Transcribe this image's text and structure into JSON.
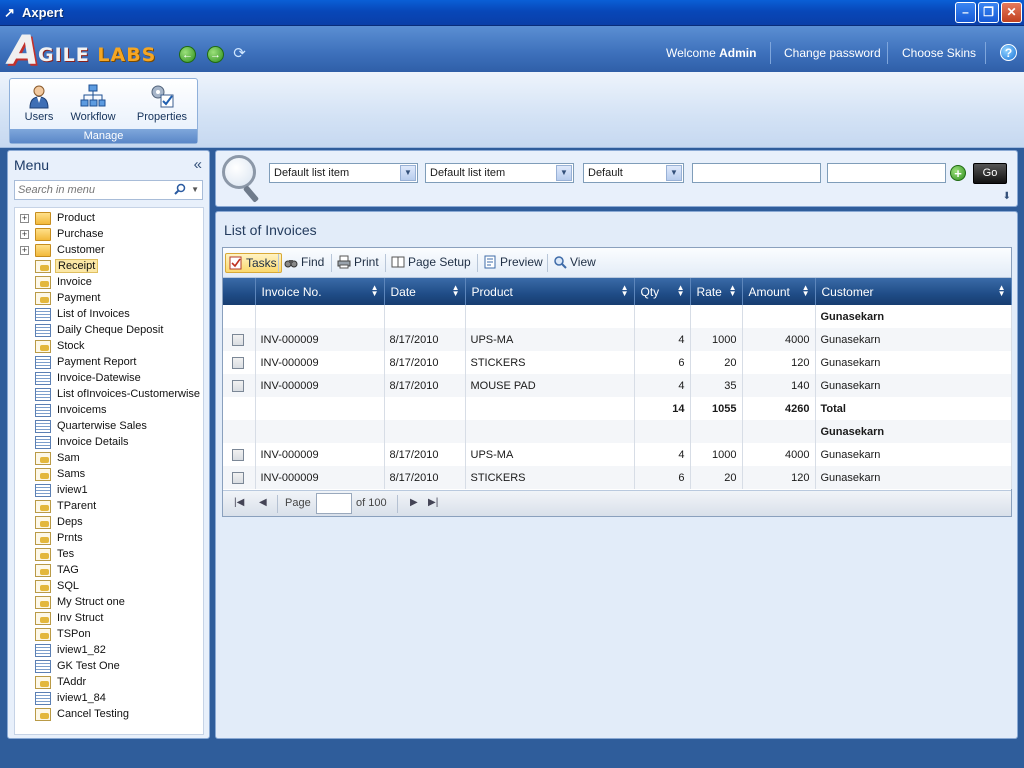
{
  "window": {
    "title": "Axpert"
  },
  "header": {
    "logo_a": "A",
    "logo_gile": "GILE",
    "logo_labs": "LABS",
    "welcome_prefix": "Welcome",
    "user": "Admin",
    "change_password": "Change password",
    "choose_skins": "Choose Skins"
  },
  "ribbon": {
    "items": [
      {
        "label": "Users",
        "icon": "user-icon"
      },
      {
        "label": "Workflow",
        "icon": "workflow-icon"
      },
      {
        "label": "Properties",
        "icon": "properties-icon"
      }
    ],
    "group_caption": "Manage"
  },
  "menu": {
    "title": "Menu",
    "search_placeholder": "Search in menu",
    "items": [
      {
        "label": "Product",
        "type": "folder",
        "expandable": true
      },
      {
        "label": "Purchase",
        "type": "folder",
        "expandable": true
      },
      {
        "label": "Customer",
        "type": "folder",
        "expandable": true
      },
      {
        "label": "Receipt",
        "type": "form",
        "selected": true
      },
      {
        "label": "Invoice",
        "type": "form"
      },
      {
        "label": "Payment",
        "type": "form"
      },
      {
        "label": "List of Invoices",
        "type": "grid"
      },
      {
        "label": "Daily Cheque Deposit",
        "type": "grid"
      },
      {
        "label": "Stock",
        "type": "form"
      },
      {
        "label": "Payment Report",
        "type": "grid"
      },
      {
        "label": "Invoice-Datewise",
        "type": "grid"
      },
      {
        "label": "List ofInvoices-Customerwise",
        "type": "grid"
      },
      {
        "label": "Invoicems",
        "type": "grid"
      },
      {
        "label": "Quarterwise Sales",
        "type": "grid"
      },
      {
        "label": "Invoice Details",
        "type": "grid"
      },
      {
        "label": "Sam",
        "type": "form"
      },
      {
        "label": "Sams",
        "type": "form"
      },
      {
        "label": "iview1",
        "type": "grid"
      },
      {
        "label": "TParent",
        "type": "form"
      },
      {
        "label": "Deps",
        "type": "form"
      },
      {
        "label": "Prnts",
        "type": "form"
      },
      {
        "label": "Tes",
        "type": "form"
      },
      {
        "label": "TAG",
        "type": "form"
      },
      {
        "label": "SQL",
        "type": "form"
      },
      {
        "label": "My Struct one",
        "type": "form"
      },
      {
        "label": "Inv Struct",
        "type": "form"
      },
      {
        "label": "TSPon",
        "type": "form"
      },
      {
        "label": "iview1_82",
        "type": "grid"
      },
      {
        "label": "GK Test One",
        "type": "grid"
      },
      {
        "label": "TAddr",
        "type": "form"
      },
      {
        "label": "iview1_84",
        "type": "grid"
      },
      {
        "label": "Cancel Testing",
        "type": "form"
      }
    ]
  },
  "filter": {
    "select1": "Default list item",
    "select2": "Default list item",
    "select3": "Default",
    "go_label": "Go"
  },
  "page": {
    "title": "List of Invoices"
  },
  "toolbar": {
    "tasks": "Tasks",
    "find": "Find",
    "print": "Print",
    "page_setup": "Page Setup",
    "preview": "Preview",
    "view": "View"
  },
  "grid": {
    "columns": [
      "Invoice No.",
      "Date",
      "Product",
      "Qty",
      "Rate",
      "Amount",
      "Customer"
    ],
    "rows": [
      {
        "kind": "group",
        "customer": "Gunasekarn"
      },
      {
        "kind": "data",
        "invoice": "INV-000009",
        "date": "8/17/2010",
        "product": "UPS-MA",
        "qty": "4",
        "rate": "1000",
        "amount": "4000",
        "customer": "Gunasekarn"
      },
      {
        "kind": "data",
        "invoice": "INV-000009",
        "date": "8/17/2010",
        "product": "STICKERS",
        "qty": "6",
        "rate": "20",
        "amount": "120",
        "customer": "Gunasekarn"
      },
      {
        "kind": "data",
        "invoice": "INV-000009",
        "date": "8/17/2010",
        "product": "MOUSE PAD",
        "qty": "4",
        "rate": "35",
        "amount": "140",
        "customer": "Gunasekarn"
      },
      {
        "kind": "total",
        "qty": "14",
        "rate": "1055",
        "amount": "4260",
        "customer": "Total"
      },
      {
        "kind": "group",
        "customer": "Gunasekarn"
      },
      {
        "kind": "data",
        "invoice": "INV-000009",
        "date": "8/17/2010",
        "product": "UPS-MA",
        "qty": "4",
        "rate": "1000",
        "amount": "4000",
        "customer": "Gunasekarn"
      },
      {
        "kind": "data",
        "invoice": "INV-000009",
        "date": "8/17/2010",
        "product": "STICKERS",
        "qty": "6",
        "rate": "20",
        "amount": "120",
        "customer": "Gunasekarn"
      }
    ]
  },
  "pager": {
    "page_label": "Page",
    "of_label": "of 100"
  }
}
